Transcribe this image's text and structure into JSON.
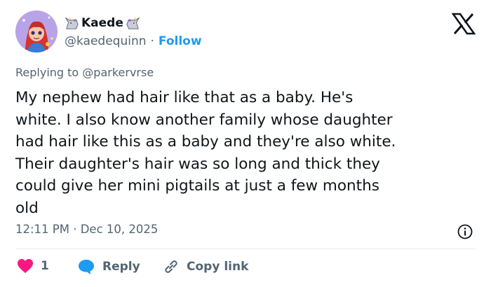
{
  "author": {
    "display_name": "Kaede",
    "handle": "@kaedequinn",
    "separator": "·",
    "follow_label": "Follow",
    "name_icons": [
      "unicorn-icon",
      "unicorn-icon"
    ]
  },
  "tweet": {
    "replying_to": "Replying to @parkervrse",
    "text": "My nephew had hair like that as a baby. He's\nwhite. I also know another family whose daughter\nhad hair like this as a baby and they're also white.\nTheir daughter's hair was so long and thick they\ncould give her mini pigtails at just a few months\nold",
    "timestamp": "12:11 PM · Dec 10, 2025"
  },
  "actions": {
    "like_count": "1",
    "reply_label": "Reply",
    "copy_link_label": "Copy link"
  },
  "colors": {
    "like": "#f91880",
    "reply": "#1d9bf0",
    "link": "#1d9bf0",
    "muted": "#536471",
    "text": "#0f1419"
  }
}
